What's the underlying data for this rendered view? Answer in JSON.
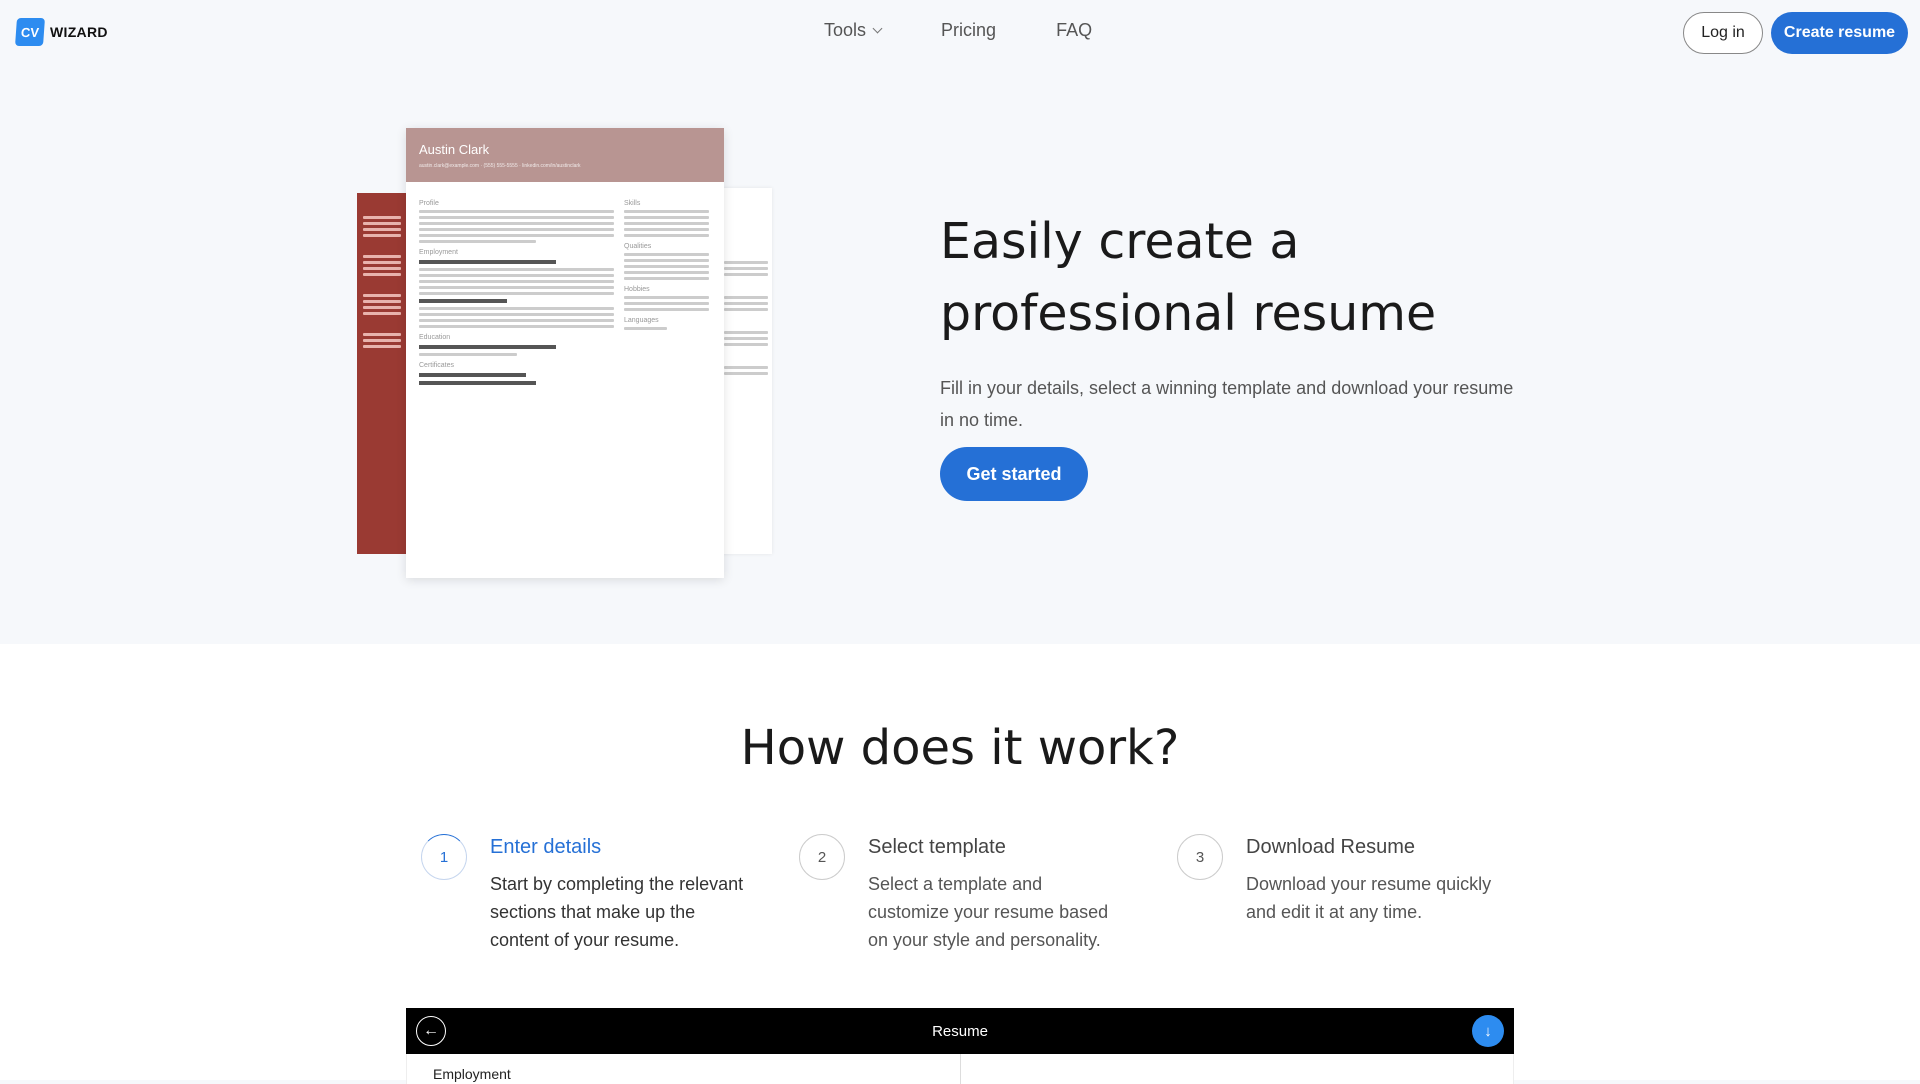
{
  "nav": {
    "logo_mark": "CV",
    "logo_text": "WIZARD",
    "links": [
      "Tools",
      "Pricing",
      "FAQ"
    ],
    "login": "Log in",
    "create": "Create resume"
  },
  "hero": {
    "title_line1": "Easily create a",
    "title_line2": "professional resume",
    "subtitle": "Fill in your details, select a winning template and download your resume in no time.",
    "cta": "Get started",
    "resume_preview": {
      "name": "Austin Clark",
      "contact": "austin.clark@example.com · (555) 555-5555 · linkedin.com/in/austinclark",
      "sections_main": [
        "Profile",
        "Employment",
        "Education",
        "Certificates"
      ],
      "sections_side": [
        "Skills",
        "Qualities",
        "Hobbies",
        "Languages"
      ]
    }
  },
  "how": {
    "title": "How does it work?",
    "steps": [
      {
        "num": "1",
        "title": "Enter details",
        "desc": "Start by completing the relevant sections that make up the content of your resume."
      },
      {
        "num": "2",
        "title": "Select template",
        "desc": "Select a template and customize your resume based on your style and personality."
      },
      {
        "num": "3",
        "title": "Download Resume",
        "desc": "Download your resume quickly and edit it at any time."
      }
    ]
  },
  "editor": {
    "title": "Resume",
    "section_label": "Employment"
  },
  "colors": {
    "accent": "#2570d6",
    "resume_header": "#b89592",
    "resume_sidebar": "#9a3a33"
  }
}
